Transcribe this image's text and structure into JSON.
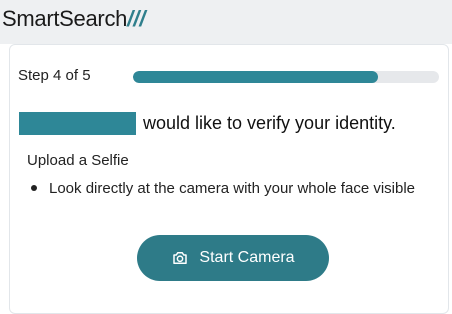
{
  "header": {
    "brand_name": "SmartSearch",
    "brand_mark": "///"
  },
  "progress": {
    "step_label": "Step 4 of 5",
    "fraction": 0.8
  },
  "verification": {
    "message": "would like to verify your identity."
  },
  "selfie": {
    "title": "Upload a Selfie",
    "instructions": [
      "Look directly at the camera with your whole face visible"
    ]
  },
  "actions": {
    "start_camera_label": "Start Camera",
    "start_camera_icon": "camera-icon"
  },
  "colors": {
    "accent": "#2e8797",
    "button": "#2e7b88",
    "header_bg": "#eef0f2"
  }
}
